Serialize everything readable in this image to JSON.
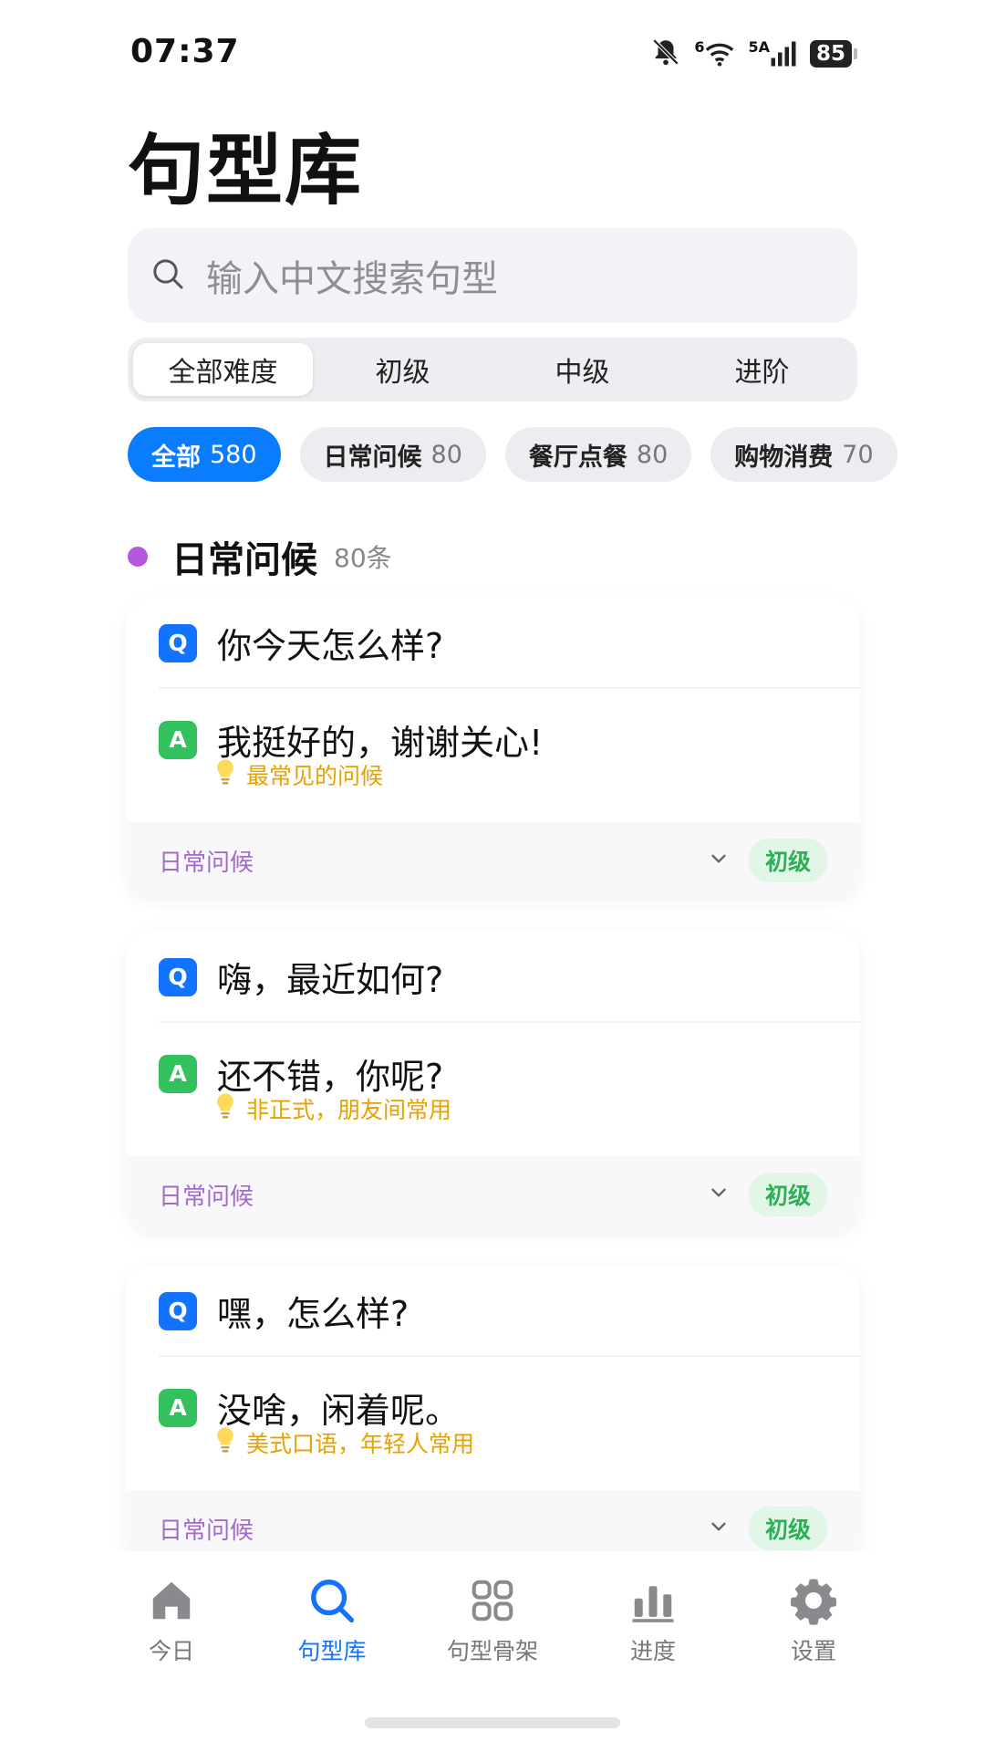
{
  "status_bar": {
    "time": "07:37",
    "network_label": "6",
    "signal_label": "5A",
    "battery": "85"
  },
  "page": {
    "title": "句型库"
  },
  "search": {
    "placeholder": "输入中文搜索句型"
  },
  "difficulty_tabs": [
    {
      "label": "全部难度",
      "active": true
    },
    {
      "label": "初级",
      "active": false
    },
    {
      "label": "中级",
      "active": false
    },
    {
      "label": "进阶",
      "active": false
    }
  ],
  "category_chips": [
    {
      "label": "全部",
      "count": "580",
      "active": true
    },
    {
      "label": "日常问候",
      "count": "80",
      "active": false
    },
    {
      "label": "餐厅点餐",
      "count": "80",
      "active": false
    },
    {
      "label": "购物消费",
      "count": "70",
      "active": false
    }
  ],
  "section": {
    "title": "日常问候",
    "count": "80条",
    "dot_color": "#b557e0"
  },
  "cards": [
    {
      "q_badge": "Q",
      "question": "你今天怎么样?",
      "a_badge": "A",
      "answer": "我挺好的，谢谢关心!",
      "note": "最常见的问候",
      "category": "日常问候",
      "level": "初级"
    },
    {
      "q_badge": "Q",
      "question": "嗨，最近如何?",
      "a_badge": "A",
      "answer": "还不错，你呢?",
      "note": "非正式，朋友间常用",
      "category": "日常问候",
      "level": "初级"
    },
    {
      "q_badge": "Q",
      "question": "嘿，怎么样?",
      "a_badge": "A",
      "answer": "没啥，闲着呢。",
      "note": "美式口语，年轻人常用",
      "category": "日常问候",
      "level": "初级"
    }
  ],
  "nav": [
    {
      "label": "今日",
      "icon": "home-icon",
      "active": false
    },
    {
      "label": "句型库",
      "icon": "search-icon",
      "active": true
    },
    {
      "label": "句型骨架",
      "icon": "grid-icon",
      "active": false
    },
    {
      "label": "进度",
      "icon": "bar-chart-icon",
      "active": false
    },
    {
      "label": "设置",
      "icon": "gear-icon",
      "active": false
    }
  ],
  "colors": {
    "accent": "#1273ff",
    "q_badge": "#1273ff",
    "a_badge": "#32c15c",
    "note": "#e6a200",
    "category": "#a26ac9",
    "level": "#2fae58"
  }
}
